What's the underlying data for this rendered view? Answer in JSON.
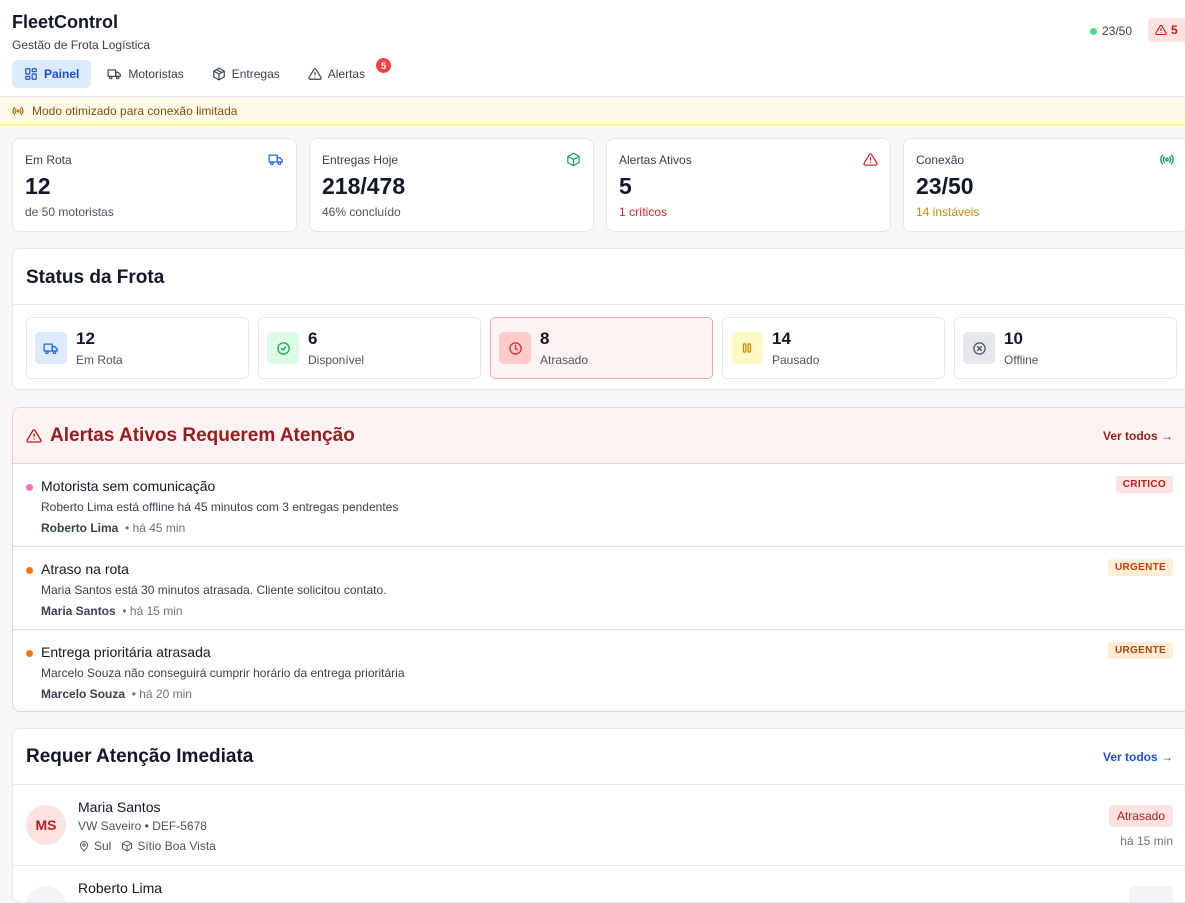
{
  "app": {
    "title": "FleetControl",
    "subtitle": "Gestão de Frota Logística"
  },
  "header_status": {
    "connection": "23/50",
    "alerts": "5"
  },
  "tabs": [
    {
      "label": "Painel",
      "icon": "dashboard-icon",
      "active": true
    },
    {
      "label": "Motoristas",
      "icon": "truck-icon"
    },
    {
      "label": "Entregas",
      "icon": "package-icon"
    },
    {
      "label": "Alertas",
      "icon": "alert-triangle-icon",
      "badge": "5"
    }
  ],
  "banner": {
    "text": "Modo otimizado para conexão limitada",
    "icon": "signal-icon"
  },
  "stats": [
    {
      "label": "Em Rota",
      "value": "12",
      "sub": "de 50 motoristas",
      "icon": "truck-icon",
      "icon_color": "#2563eb",
      "sub_color": "#4b5563"
    },
    {
      "label": "Entregas Hoje",
      "value": "218/478",
      "sub": "46% concluído",
      "icon": "package-icon",
      "icon_color": "#16a34a",
      "sub_color": "#4b5563"
    },
    {
      "label": "Alertas Ativos",
      "value": "5",
      "sub": "1 críticos",
      "icon": "alert-triangle-icon",
      "icon_color": "#dc2626",
      "sub_color": "#dc2626"
    },
    {
      "label": "Conexão",
      "value": "23/50",
      "sub": "14 instáveis",
      "icon": "signal-icon",
      "icon_color": "#16a34a",
      "sub_color": "#ca8a04"
    }
  ],
  "fleet_status": {
    "title": "Status da Frota",
    "items": [
      {
        "count": "12",
        "label": "Em Rota",
        "icon": "truck-icon",
        "bg": "#dbeafe",
        "fg": "#2563eb"
      },
      {
        "count": "6",
        "label": "Disponível",
        "icon": "check-circle-icon",
        "bg": "#dcfce7",
        "fg": "#16a34a"
      },
      {
        "count": "8",
        "label": "Atrasado",
        "icon": "clock-icon",
        "bg": "#fecaca",
        "fg": "#dc2626"
      },
      {
        "count": "14",
        "label": "Pausado",
        "icon": "pause-icon",
        "bg": "#fef9c3",
        "fg": "#ca8a04"
      },
      {
        "count": "10",
        "label": "Offline",
        "icon": "x-circle-icon",
        "bg": "#e5e7eb",
        "fg": "#4b5563"
      }
    ]
  },
  "alerts": {
    "title": "Alertas Ativos Requerem Atenção",
    "view_all": "Ver todos →",
    "items": [
      {
        "title": "Motorista sem comunicação",
        "description": "Roberto Lima está offline há 45 minutos com 3 entregas pendentes",
        "driver": "Roberto Lima",
        "time": "• há 45 min",
        "badge": "CRITICO",
        "dot": "#f472b6",
        "badge_bg": "#fee2e2",
        "badge_fg": "#b91c1c"
      },
      {
        "title": "Atraso na rota",
        "description": "Maria Santos está 30 minutos atrasada. Cliente solicitou contato.",
        "driver": "Maria Santos",
        "time": "• há 15 min",
        "badge": "URGENTE",
        "dot": "#f97316",
        "badge_bg": "#ffedd5",
        "badge_fg": "#c2410c"
      },
      {
        "title": "Entrega prioritária atrasada",
        "description": "Marcelo Souza não conseguirá cumprir horário da entrega prioritária",
        "driver": "Marcelo Souza",
        "time": "• há 20 min",
        "badge": "URGENTE",
        "dot": "#f97316",
        "badge_bg": "#ffedd5",
        "badge_fg": "#c2410c"
      }
    ]
  },
  "attention": {
    "title": "Requer Atenção Imediata",
    "view_all": "Ver todos →",
    "drivers": [
      {
        "initials": "MS",
        "name": "Maria Santos",
        "vehicle": "VW Saveiro • DEF-5678",
        "region": "Sul",
        "destination": "Sítio Boa Vista",
        "status": "Atrasado",
        "time": "há 15 min",
        "avatar_bg": "#fee2e2",
        "avatar_fg": "#b91c1c",
        "status_bg": "#fee2e2",
        "status_fg": "#b91c1c"
      },
      {
        "initials": "",
        "name": "Roberto Lima",
        "vehicle": "",
        "region": "",
        "destination": "",
        "status": "",
        "time": "",
        "avatar_bg": "#f3f4f6",
        "avatar_fg": "#4b5563",
        "status_bg": "#f3f4f6",
        "status_fg": "#4b5563"
      }
    ]
  }
}
